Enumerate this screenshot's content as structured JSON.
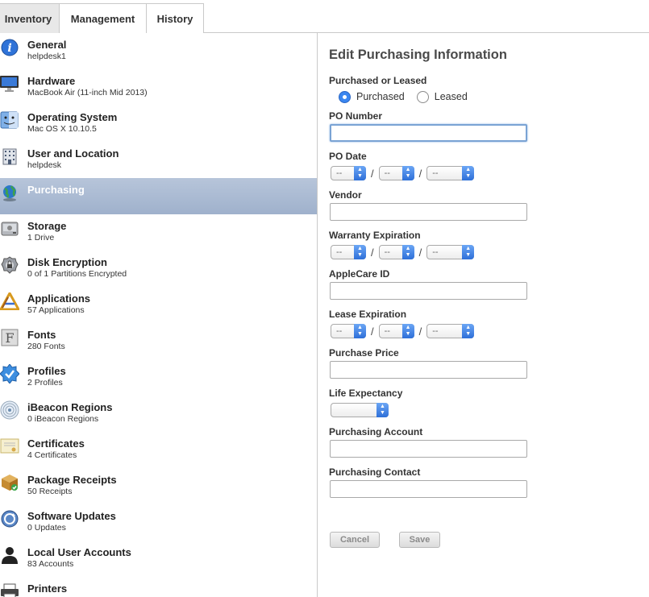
{
  "tabs": [
    {
      "label": "Inventory"
    },
    {
      "label": "Management"
    },
    {
      "label": "History"
    }
  ],
  "sidebar": {
    "items": [
      {
        "label": "General",
        "sub": "helpdesk1",
        "icon": "info-icon"
      },
      {
        "label": "Hardware",
        "sub": "MacBook Air (11-inch Mid 2013)",
        "icon": "display-icon"
      },
      {
        "label": "Operating System",
        "sub": "Mac OS X 10.10.5",
        "icon": "finder-icon"
      },
      {
        "label": "User and Location",
        "sub": "helpdesk",
        "icon": "building-icon"
      },
      {
        "label": "Purchasing",
        "sub": "",
        "icon": "globe-icon"
      },
      {
        "label": "Storage",
        "sub": "1 Drive",
        "icon": "disk-icon"
      },
      {
        "label": "Disk Encryption",
        "sub": "0 of 1 Partitions Encrypted",
        "icon": "lock-gear-icon"
      },
      {
        "label": "Applications",
        "sub": "57 Applications",
        "icon": "applications-icon"
      },
      {
        "label": "Fonts",
        "sub": "280 Fonts",
        "icon": "font-icon"
      },
      {
        "label": "Profiles",
        "sub": "2 Profiles",
        "icon": "badge-icon"
      },
      {
        "label": "iBeacon Regions",
        "sub": "0 iBeacon Regions",
        "icon": "ibeacon-icon"
      },
      {
        "label": "Certificates",
        "sub": "4 Certificates",
        "icon": "certificate-icon"
      },
      {
        "label": "Package Receipts",
        "sub": "50 Receipts",
        "icon": "package-icon"
      },
      {
        "label": "Software Updates",
        "sub": "0 Updates",
        "icon": "software-update-icon"
      },
      {
        "label": "Local User Accounts",
        "sub": "83 Accounts",
        "icon": "user-icon"
      },
      {
        "label": "Printers",
        "sub": "",
        "icon": "printer-icon"
      }
    ]
  },
  "form": {
    "title": "Edit Purchasing Information",
    "purchased_or_leased_label": "Purchased or Leased",
    "purchased_label": "Purchased",
    "leased_label": "Leased",
    "po_number_label": "PO Number",
    "po_number_value": "",
    "po_date_label": "PO Date",
    "vendor_label": "Vendor",
    "vendor_value": "",
    "warranty_label": "Warranty Expiration",
    "applecare_label": "AppleCare ID",
    "applecare_value": "",
    "lease_label": "Lease Expiration",
    "price_label": "Purchase Price",
    "price_value": "",
    "life_label": "Life Expectancy",
    "life_value": "",
    "account_label": "Purchasing Account",
    "account_value": "",
    "contact_label": "Purchasing Contact",
    "contact_value": "",
    "date_placeholder": "--",
    "date_separator": "/",
    "cancel_label": "Cancel",
    "save_label": "Save"
  }
}
